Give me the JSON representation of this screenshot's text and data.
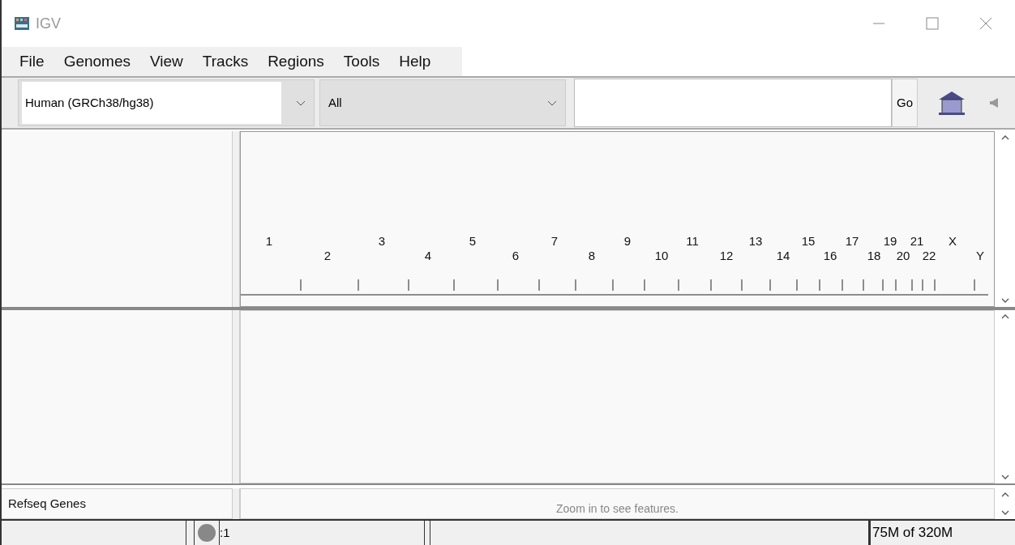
{
  "window": {
    "title": "IGV"
  },
  "menu": [
    "File",
    "Genomes",
    "View",
    "Tracks",
    "Regions",
    "Tools",
    "Help"
  ],
  "toolbar": {
    "genome": "Human (GRCh38/hg38)",
    "chromosome": "All",
    "go": "Go"
  },
  "chromosomes": [
    "1",
    "2",
    "3",
    "4",
    "5",
    "6",
    "7",
    "8",
    "9",
    "10",
    "11",
    "12",
    "13",
    "14",
    "15",
    "16",
    "17",
    "18",
    "19",
    "20",
    "21",
    "22",
    "X",
    "Y"
  ],
  "feature_track": {
    "name": "Refseq Genes",
    "message": "Zoom in to see features."
  },
  "status_bar": {
    "position": ":1",
    "memory": "75M of 320M"
  }
}
